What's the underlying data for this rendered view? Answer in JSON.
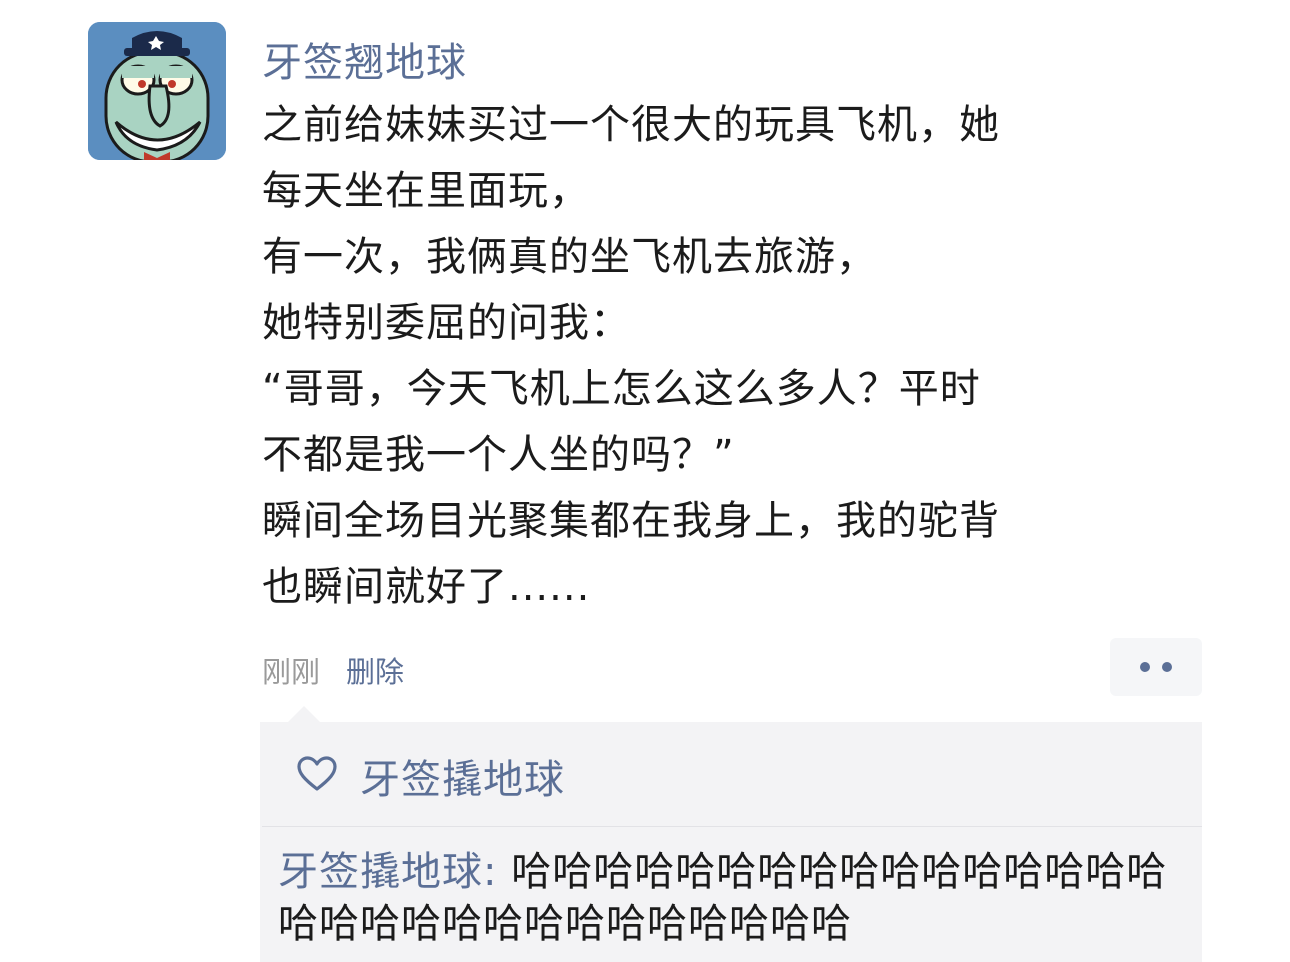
{
  "post": {
    "author_name": "牙签翘地球",
    "lines": [
      "之前给妹妹买过一个很大的玩具飞机，她",
      "每天坐在里面玩，",
      "有一次，我俩真的坐飞机去旅游，",
      "她特别委屈的问我：",
      "“哥哥，今天飞机上怎么这么多人？平时",
      "不都是我一个人坐的吗？”",
      "瞬间全场目光聚集都在我身上，我的驼背",
      "也瞬间就好了......"
    ],
    "time": "刚刚",
    "delete_label": "删除"
  },
  "icons": {
    "more": "more-dots-icon",
    "like": "heart-outline-icon"
  },
  "likes": {
    "names": "牙签撬地球"
  },
  "comments": [
    {
      "author": "牙签撬地球",
      "separator": ": ",
      "text": "哈哈哈哈哈哈哈哈哈哈哈哈哈哈哈哈哈哈哈哈哈哈哈哈哈哈哈哈哈哈"
    }
  ],
  "colors": {
    "link": "#5b6f96",
    "text": "#1b1b1b",
    "muted": "#9a9a9a",
    "comment_bg": "#f3f3f5"
  }
}
